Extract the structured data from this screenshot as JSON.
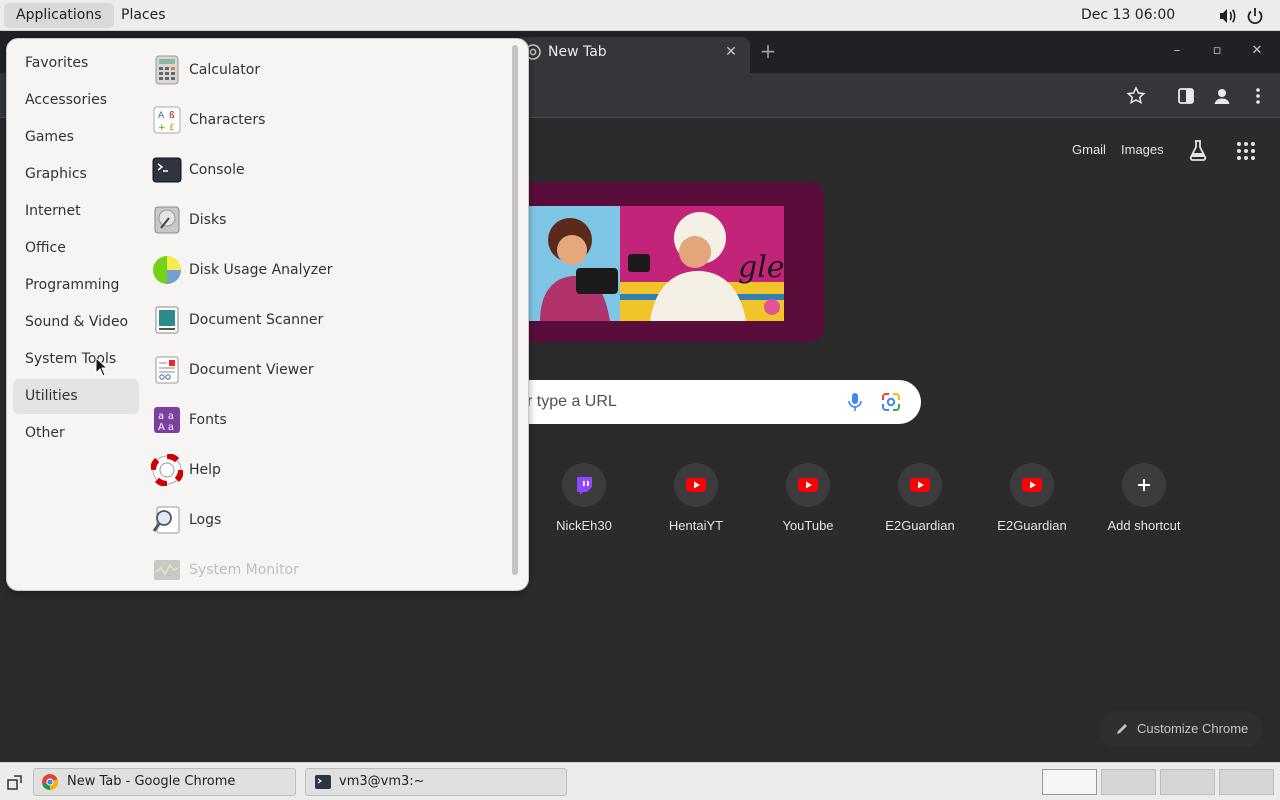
{
  "topbar": {
    "applications_label": "Applications",
    "places_label": "Places",
    "clock": "Dec 13  06:00",
    "icons": [
      "volume-icon",
      "power-icon"
    ]
  },
  "chrome": {
    "tab_title": "New Tab",
    "ntp": {
      "gmail_label": "Gmail",
      "images_label": "Images",
      "search_placeholder": "r type a URL",
      "shortcuts": [
        {
          "label": "NickEh30",
          "icon": "twitch-icon",
          "color": "#9146ff"
        },
        {
          "label": "HentaiYT",
          "icon": "youtube-icon",
          "color": "#ff0000"
        },
        {
          "label": "YouTube",
          "icon": "youtube-icon",
          "color": "#ff0000"
        },
        {
          "label": "E2Guardian",
          "icon": "youtube-icon",
          "color": "#ff0000"
        },
        {
          "label": "E2Guardian",
          "icon": "youtube-icon",
          "color": "#ff0000"
        },
        {
          "label": "Add shortcut",
          "icon": "plus-icon",
          "color": "#ffffff"
        }
      ],
      "customize_label": "Customize Chrome"
    }
  },
  "appmenu": {
    "categories": [
      {
        "label": "Favorites"
      },
      {
        "label": "Accessories"
      },
      {
        "label": "Games"
      },
      {
        "label": "Graphics"
      },
      {
        "label": "Internet"
      },
      {
        "label": "Office"
      },
      {
        "label": "Programming"
      },
      {
        "label": "Sound & Video"
      },
      {
        "label": "System Tools"
      },
      {
        "label": "Utilities",
        "selected": true
      },
      {
        "label": "Other"
      }
    ],
    "apps": [
      {
        "label": "Calculator",
        "icon": "calculator-icon"
      },
      {
        "label": "Characters",
        "icon": "characters-icon"
      },
      {
        "label": "Console",
        "icon": "console-icon"
      },
      {
        "label": "Disks",
        "icon": "disks-icon"
      },
      {
        "label": "Disk Usage Analyzer",
        "icon": "disk-usage-icon"
      },
      {
        "label": "Document Scanner",
        "icon": "scanner-icon"
      },
      {
        "label": "Document Viewer",
        "icon": "document-viewer-icon"
      },
      {
        "label": "Fonts",
        "icon": "fonts-icon"
      },
      {
        "label": "Help",
        "icon": "help-icon"
      },
      {
        "label": "Logs",
        "icon": "logs-icon"
      },
      {
        "label": "System Monitor",
        "icon": "system-monitor-icon"
      }
    ]
  },
  "taskbar": {
    "tasks": [
      {
        "label": "New Tab - Google Chrome",
        "icon": "chrome-icon"
      },
      {
        "label": "vm3@vm3:~",
        "icon": "terminal-icon"
      }
    ],
    "workspaces": 4
  },
  "colors": {
    "accent_twitch": "#9146ff",
    "accent_youtube": "#ff0000",
    "menu_bg": "#f6f5f4",
    "chrome_dark": "#202124"
  }
}
